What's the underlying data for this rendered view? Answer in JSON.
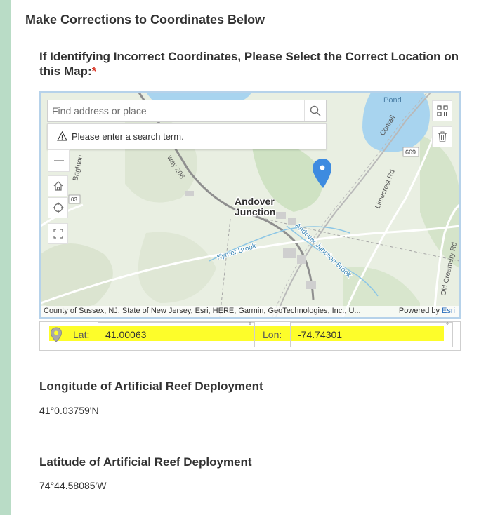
{
  "section": {
    "title": "Make Corrections to Coordinates Below"
  },
  "question": {
    "label": "If Identifying Incorrect Coordinates, Please Select the Correct Location on this Map:",
    "required_mark": "*"
  },
  "map": {
    "search": {
      "placeholder": "Find address or place",
      "value": ""
    },
    "search_warning": "Please enter a search term.",
    "labels": {
      "pond": "Pond",
      "conrail": "Conrail",
      "route_669": "669",
      "brighton": "Brighton",
      "route_206": "way 206",
      "shield_03": "03",
      "andover": "Andover",
      "junction": "Junction",
      "limecrest": "Limecrest Rd",
      "kymer_brook": "Kymer Brook",
      "andover_junction_brook": "Andover Junction Brook",
      "old_creamery": "Old Creamery Rd"
    },
    "attribution": "County of Sussex, NJ, State of New Jersey, Esri, HERE, Garmin, GeoTechnologies, Inc., U...",
    "powered_by": "Powered by",
    "esri": "Esri"
  },
  "coordinates": {
    "lat_label": "Lat:",
    "lat_value": "41.00063",
    "lon_label": "Lon:",
    "lon_value": "-74.74301",
    "degree_symbol": "°"
  },
  "fields": [
    {
      "title": "Longitude of Artificial Reef Deployment",
      "value": "41°0.03759'N"
    },
    {
      "title": "Latitude of Artificial Reef Deployment",
      "value": "74°44.58085'W"
    }
  ],
  "colors": {
    "accent_bar": "#b9dcc6",
    "highlight": "#fdfd2a",
    "map_pin": "#3d8be0",
    "required": "#d83020",
    "water": "#a8d4ef",
    "land": "#e8efe0"
  }
}
